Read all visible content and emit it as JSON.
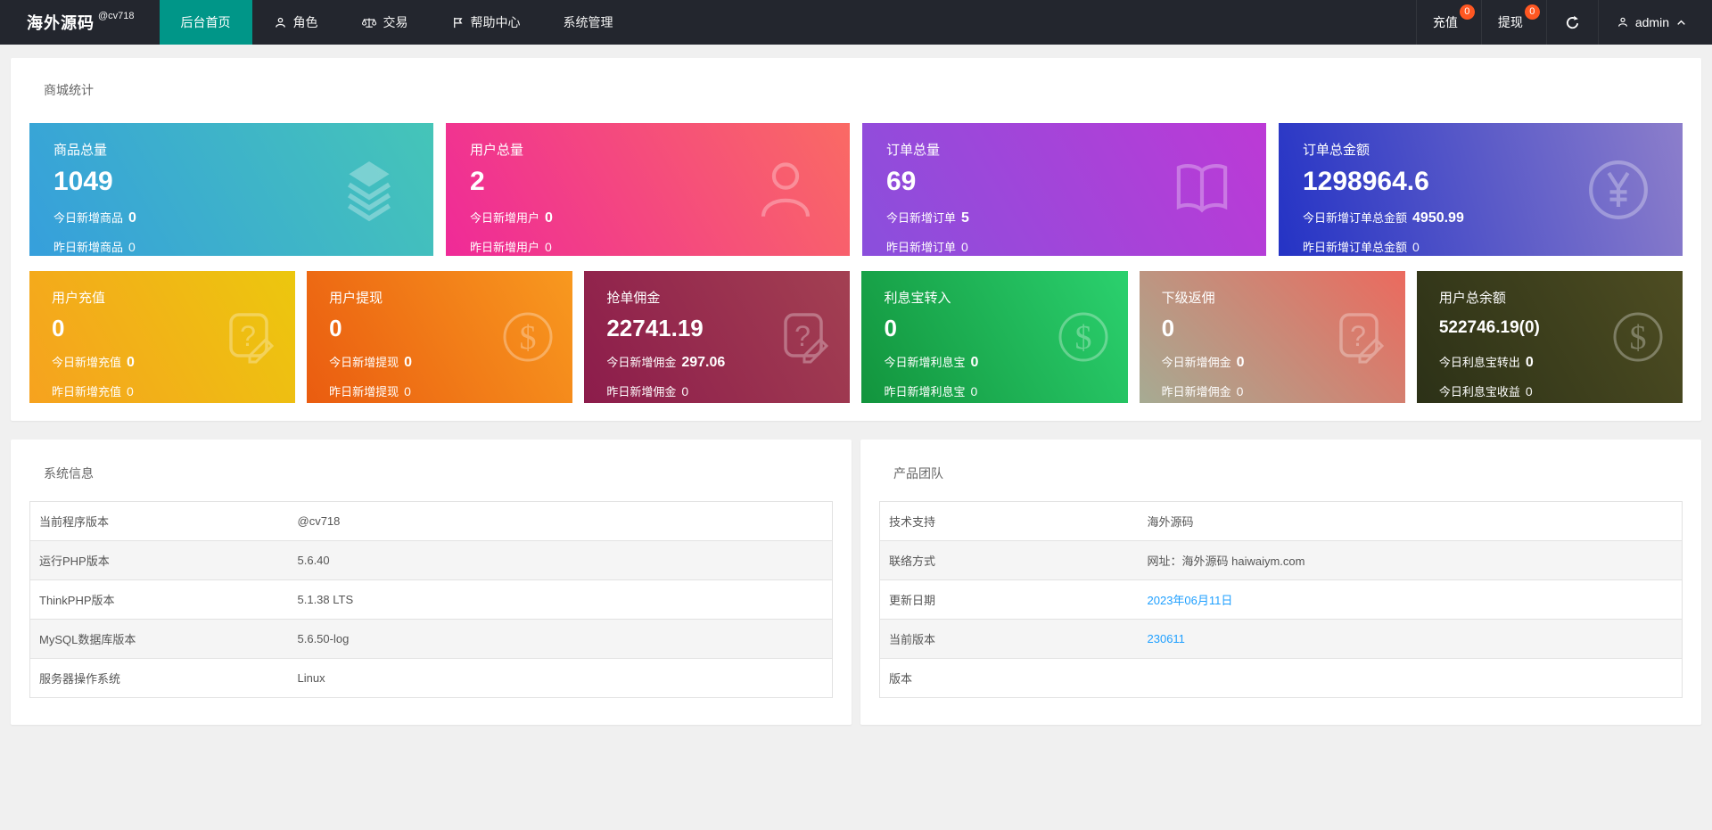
{
  "colors": {
    "accent": "#009688",
    "badge": "#ff5722",
    "link": "#1e9fff"
  },
  "navbar": {
    "brand": "海外源码",
    "brand_sup": "@cv718",
    "menu": [
      {
        "label": "后台首页"
      },
      {
        "label": "角色",
        "icon": "user-icon"
      },
      {
        "label": "交易",
        "icon": "scales-icon"
      },
      {
        "label": "帮助中心",
        "icon": "flag-icon"
      },
      {
        "label": "系统管理"
      }
    ],
    "recharge": {
      "label": "充值",
      "badge": "0"
    },
    "withdraw": {
      "label": "提现",
      "badge": "0"
    },
    "user": {
      "name": "admin"
    }
  },
  "stats_panel": {
    "title": "商城统计",
    "primary_cards": [
      {
        "title": "商品总量",
        "value": "1049",
        "line1": {
          "label": "今日新增商品",
          "value": "0"
        },
        "line2": {
          "label": "昨日新增商品",
          "value": "0"
        },
        "icon": "layers-icon",
        "gradient": "linear-gradient(60deg, #369fdc, #45c5b8)"
      },
      {
        "title": "用户总量",
        "value": "2",
        "line1": {
          "label": "今日新增用户",
          "value": "0"
        },
        "line2": {
          "label": "昨日新增用户",
          "value": "0"
        },
        "icon": "person-icon",
        "gradient": "linear-gradient(60deg, #ef2a98, #fa6a64)"
      },
      {
        "title": "订单总量",
        "value": "69",
        "line1": {
          "label": "今日新增订单",
          "value": "5"
        },
        "line2": {
          "label": "昨日新增订单",
          "value": "0"
        },
        "icon": "book-icon",
        "gradient": "linear-gradient(60deg, #8a4fdc, #bc3ad6)"
      },
      {
        "title": "订单总金额",
        "value": "1298964.6",
        "line1": {
          "label": "今日新增订单总金额",
          "value": "4950.99"
        },
        "line2": {
          "label": "昨日新增订单总金额",
          "value": "0"
        },
        "icon": "yen-circle-icon",
        "gradient": "linear-gradient(75deg, #2433c5, #8c7ecb)"
      }
    ],
    "secondary_cards": [
      {
        "title": "用户充值",
        "value": "0",
        "line1": {
          "label": "今日新增充值",
          "value": "0"
        },
        "line2": {
          "label": "昨日新增充值",
          "value": "0"
        },
        "icon": "help-edit-icon",
        "gradient": "linear-gradient(60deg, #f6a21f, #ecc70e)"
      },
      {
        "title": "用户提现",
        "value": "0",
        "line1": {
          "label": "今日新增提现",
          "value": "0"
        },
        "line2": {
          "label": "昨日新增提现",
          "value": "0"
        },
        "icon": "dollar-circle-icon",
        "gradient": "linear-gradient(60deg, #ea5c10, #f8991f)"
      },
      {
        "title": "抢单佣金",
        "value": "22741.19",
        "line1": {
          "label": "今日新增佣金",
          "value": "297.06"
        },
        "line2": {
          "label": "昨日新增佣金",
          "value": "0"
        },
        "icon": "help-edit-icon",
        "gradient": "linear-gradient(60deg, #8c1c4b, #a34052)"
      },
      {
        "title": "利息宝转入",
        "value": "0",
        "line1": {
          "label": "今日新增利息宝",
          "value": "0"
        },
        "line2": {
          "label": "昨日新增利息宝",
          "value": "0"
        },
        "icon": "dollar-circle-icon",
        "gradient": "linear-gradient(60deg, #12943d, #2bd16e)"
      },
      {
        "title": "下级返佣",
        "value": "0",
        "line1": {
          "label": "今日新增佣金",
          "value": "0"
        },
        "line2": {
          "label": "昨日新增佣金",
          "value": "0"
        },
        "icon": "help-edit-icon",
        "gradient": "linear-gradient(225deg, #eb6a5e, #a6ab93)"
      },
      {
        "title": "用户总余额",
        "value": "522746.19(0)",
        "line1": {
          "label": "今日利息宝转出",
          "value": "0"
        },
        "line2": {
          "label": "今日利息宝收益",
          "value": "0"
        },
        "icon": "dollar-circle-icon",
        "gradient": "linear-gradient(60deg, #2c3117, #4e4d22)"
      }
    ]
  },
  "system_info": {
    "title": "系统信息",
    "rows": [
      {
        "label": "当前程序版本",
        "value": "@cv718"
      },
      {
        "label": "运行PHP版本",
        "value": "5.6.40"
      },
      {
        "label": "ThinkPHP版本",
        "value": "5.1.38 LTS"
      },
      {
        "label": "MySQL数据库版本",
        "value": "5.6.50-log"
      },
      {
        "label": "服务器操作系统",
        "value": "Linux"
      }
    ]
  },
  "product_team": {
    "title": "产品团队",
    "rows": [
      {
        "label": "技术支持",
        "value": "海外源码"
      },
      {
        "label": "联络方式",
        "value": "网址：海外源码 haiwaiym.com"
      },
      {
        "label": "更新日期",
        "value": "2023年06月11日",
        "link": true
      },
      {
        "label": "当前版本",
        "value": "230611",
        "link": true
      },
      {
        "label": "版本",
        "value": ""
      }
    ]
  }
}
